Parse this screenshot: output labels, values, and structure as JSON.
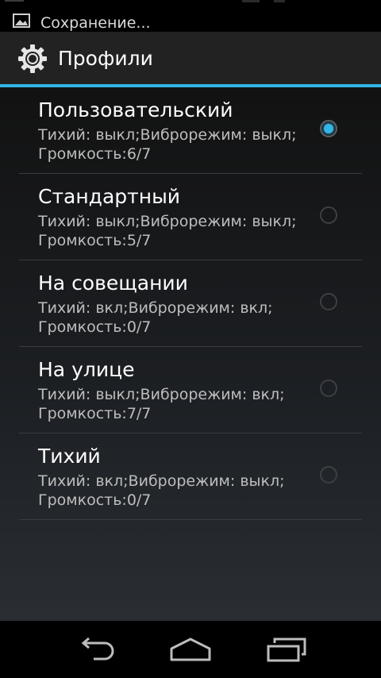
{
  "status_bar": {
    "notification_text": "Сохранение...",
    "notification_icon": "image-icon"
  },
  "action_bar": {
    "icon": "gear-icon",
    "title": "Профили",
    "accent_color": "#33b5e5"
  },
  "profiles": [
    {
      "title": "Пользовательский",
      "line1": "Тихий: выкл;Виброрежим: выкл;",
      "line2": "Громкость:6/7",
      "checked": true
    },
    {
      "title": "Стандартный",
      "line1": "Тихий: выкл;Виброрежим: выкл;",
      "line2": "Громкость:5/7",
      "checked": false
    },
    {
      "title": "На совещании",
      "line1": "Тихий: вкл;Виброрежим: вкл;",
      "line2": "Громкость:0/7",
      "checked": false
    },
    {
      "title": "На улице",
      "line1": "Тихий: выкл;Виброрежим: вкл;",
      "line2": "Громкость:7/7",
      "checked": false
    },
    {
      "title": "Тихий",
      "line1": "Тихий: вкл;Виброрежим: выкл;",
      "line2": "Громкость:0/7",
      "checked": false
    }
  ],
  "nav_bar": {
    "back_icon": "back-arrow-icon",
    "home_icon": "home-icon",
    "recent_icon": "recent-apps-icon"
  }
}
